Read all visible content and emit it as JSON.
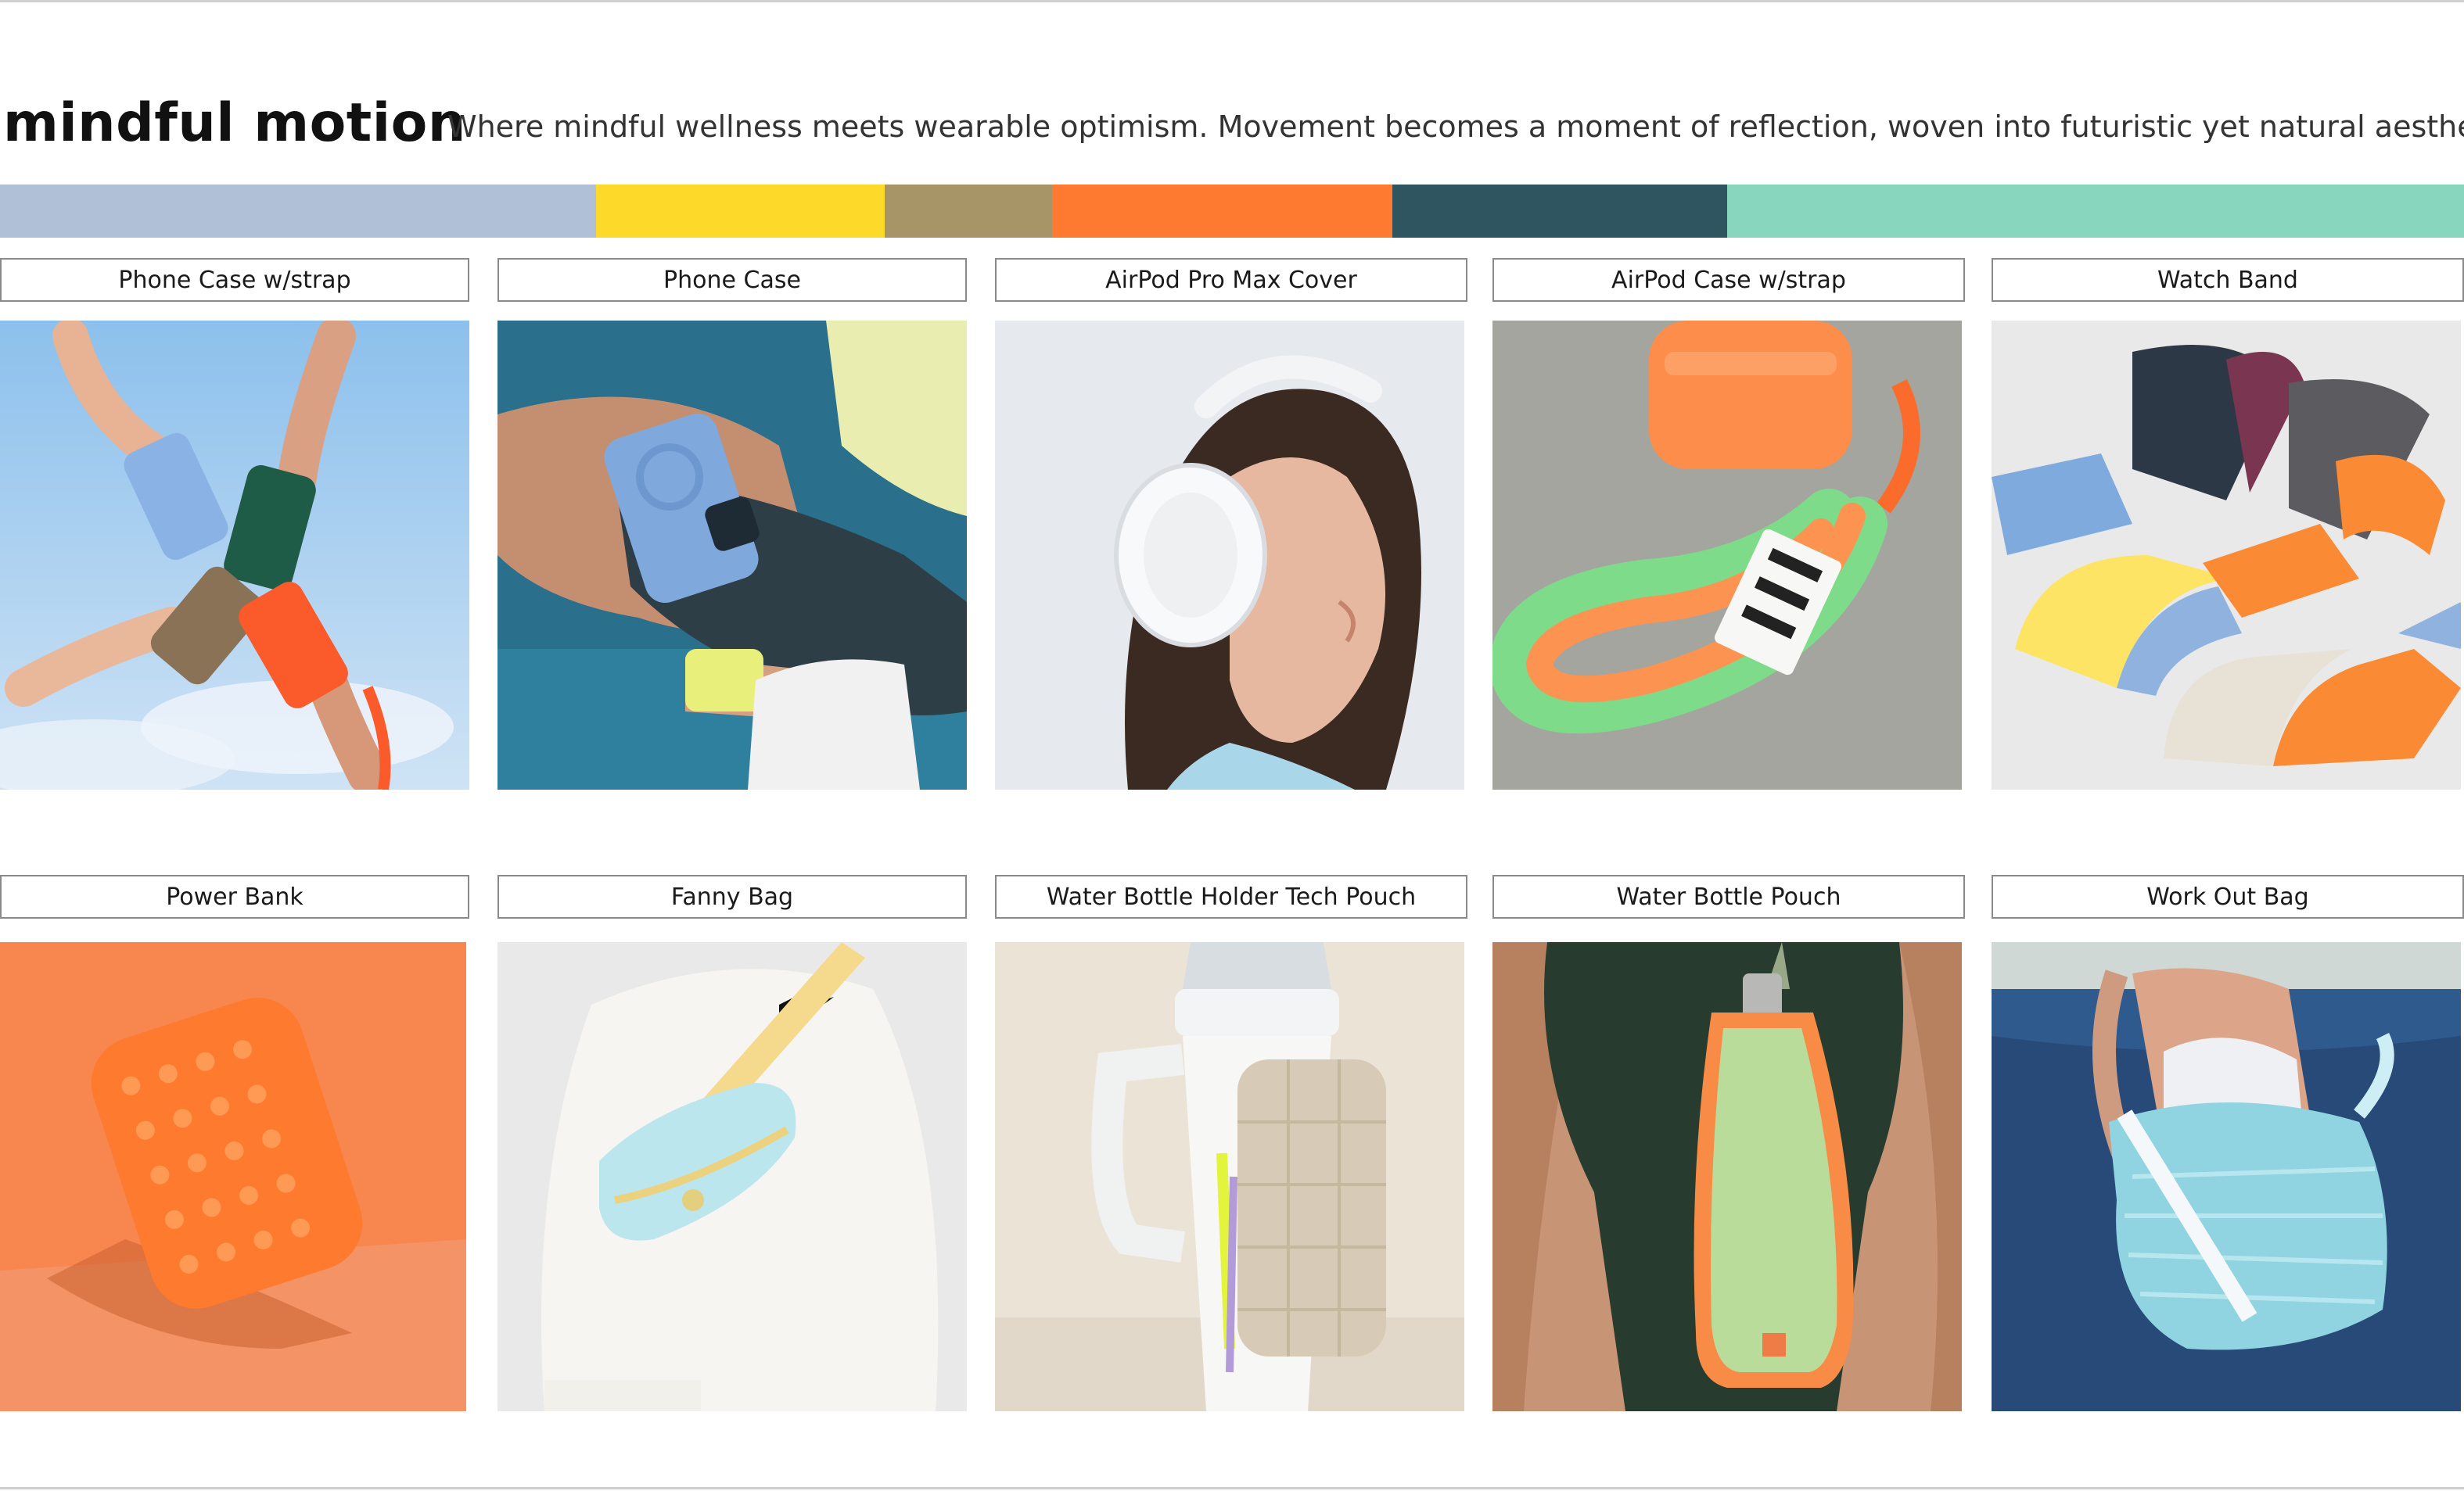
{
  "page": {
    "title": "mindful motion",
    "tagline": "Where mindful wellness meets wearable optimism. Movement becomes a moment of reflection, woven into futuristic yet natural aesthetics."
  },
  "palette": [
    {
      "name": "dusty-blue",
      "color": "#b0c0d6",
      "share": 0.242
    },
    {
      "name": "sun-yellow",
      "color": "#fdd92a",
      "share": 0.117
    },
    {
      "name": "olive-khaki",
      "color": "#a79467",
      "share": 0.068
    },
    {
      "name": "tangerine",
      "color": "#fe7a31",
      "share": 0.138
    },
    {
      "name": "deep-teal",
      "color": "#2e5560",
      "share": 0.136
    },
    {
      "name": "mint",
      "color": "#87d6bd",
      "share": 0.299
    }
  ],
  "products": [
    {
      "label": "Phone Case w/strap"
    },
    {
      "label": "Phone Case"
    },
    {
      "label": "AirPod Pro Max Cover"
    },
    {
      "label": "AirPod Case w/strap"
    },
    {
      "label": "Watch Band"
    },
    {
      "label": "Power Bank"
    },
    {
      "label": "Fanny Bag"
    },
    {
      "label": "Water Bottle Holder Tech Pouch"
    },
    {
      "label": "Water Bottle Pouch"
    },
    {
      "label": "Work Out Bag"
    }
  ]
}
